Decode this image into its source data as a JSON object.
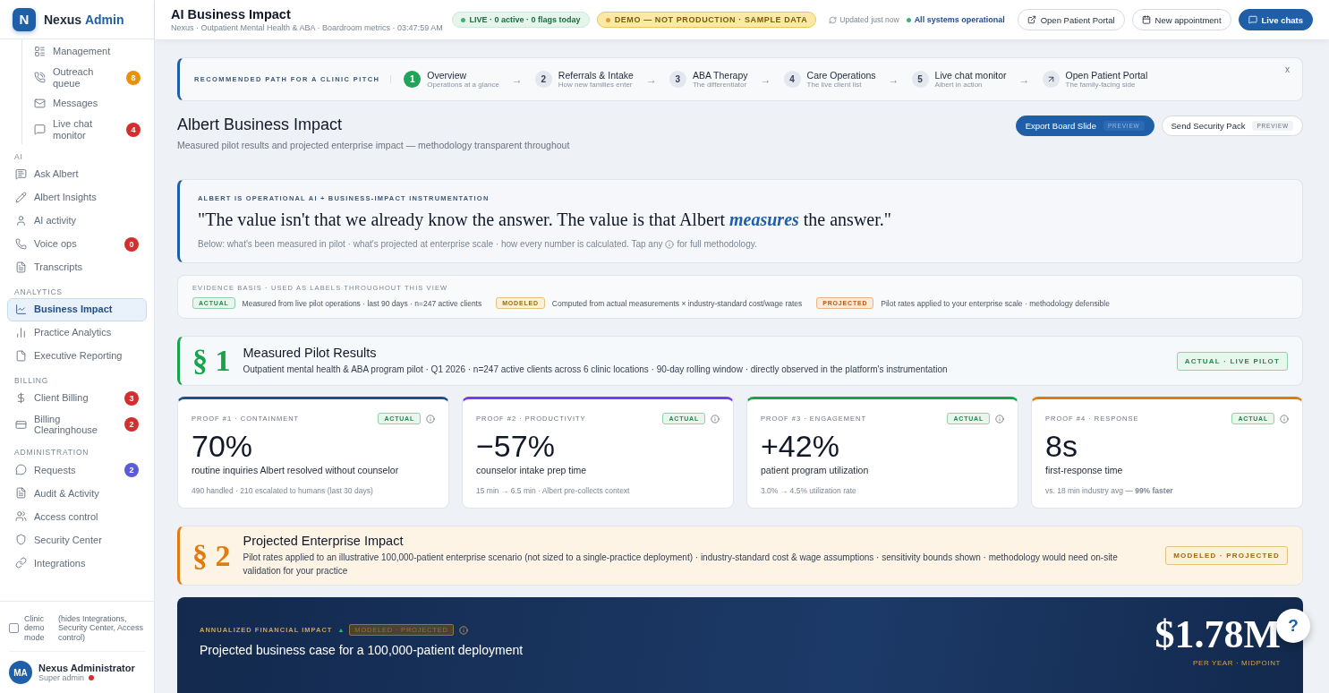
{
  "brand": {
    "logo": "N",
    "name": "Nexus",
    "name_accent": "Admin"
  },
  "sidebar": {
    "sections": [
      {
        "indented": true,
        "items": [
          {
            "label": "Management",
            "selected": false
          },
          {
            "label": "Outreach queue",
            "selected": false,
            "badge": "8",
            "color": "#e8910c"
          },
          {
            "label": "Messages",
            "selected": false
          },
          {
            "label": "Live chat monitor",
            "selected": false,
            "badge": "4",
            "color": "#d32f2f"
          }
        ]
      },
      {
        "indented": false,
        "title": "AI",
        "items": [
          {
            "label": "Ask Albert",
            "selected": false
          },
          {
            "label": "Albert Insights",
            "selected": false
          },
          {
            "label": "AI activity",
            "selected": false
          },
          {
            "label": "Voice ops",
            "selected": false,
            "badge": "0",
            "color": "#d32f2f"
          },
          {
            "label": "Transcripts",
            "selected": false
          }
        ]
      },
      {
        "indented": false,
        "title": "ANALYTICS",
        "items": [
          {
            "label": "Business Impact",
            "selected": true
          },
          {
            "label": "Practice Analytics",
            "selected": false
          },
          {
            "label": "Executive Reporting",
            "selected": false
          }
        ]
      },
      {
        "indented": false,
        "title": "BILLING",
        "items": [
          {
            "label": "Client Billing",
            "selected": false,
            "badge": "3",
            "color": "#d32f2f"
          },
          {
            "label": "Billing Clearinghouse",
            "selected": false,
            "badge": "2",
            "color": "#d32f2f"
          }
        ]
      },
      {
        "indented": false,
        "title": "ADMINISTRATION",
        "items": [
          {
            "label": "Requests",
            "selected": false,
            "badge": "2",
            "color": "#5b5bd6"
          },
          {
            "label": "Audit & Activity",
            "selected": false
          },
          {
            "label": "Access control",
            "selected": false
          },
          {
            "label": "Security Center",
            "selected": false
          },
          {
            "label": "Integrations",
            "selected": false
          }
        ]
      }
    ],
    "demo_mode": {
      "label": "Clinic demo mode",
      "note": "(hides Integrations, Security Center, Access control)",
      "checked": false
    },
    "user": {
      "initials": "MA",
      "name": "Nexus Administrator",
      "role": "Super admin",
      "color": "#d32f2f"
    }
  },
  "header": {
    "title": "AI Business Impact",
    "subtitle": "Nexus · Outpatient Mental Health & ABA · Boardroom metrics · 03:47:59 AM",
    "live_pill": "LIVE · 0 active · 0 flags today",
    "demo_pill": "DEMO — NOT PRODUCTION · SAMPLE DATA",
    "updated": "Updated",
    "updated_when": "just now",
    "status": "All systems operational",
    "buttons": [
      {
        "label": "Open Patient Portal",
        "kind": "outline"
      },
      {
        "label": "New appointment",
        "kind": "outline"
      },
      {
        "label": "Live chats",
        "kind": "primary"
      }
    ]
  },
  "pitch_path": {
    "label": "RECOMMENDED PATH FOR A CLINIC PITCH",
    "close": "x",
    "arrow": "→",
    "steps": [
      {
        "kind": "number",
        "number": "1",
        "title": "Overview",
        "subtitle": "Operations at a glance",
        "selected": true
      },
      {
        "kind": "number",
        "number": "2",
        "title": "Referrals & Intake",
        "subtitle": "How new families enter",
        "selected": false
      },
      {
        "kind": "number",
        "number": "3",
        "title": "ABA Therapy",
        "subtitle": "The differentiator",
        "selected": false
      },
      {
        "kind": "number",
        "number": "4",
        "title": "Care Operations",
        "subtitle": "The live client list",
        "selected": false
      },
      {
        "kind": "number",
        "number": "5",
        "title": "Live chat monitor",
        "subtitle": "Albert in action",
        "selected": false
      },
      {
        "kind": "link",
        "title": "Open Patient Portal",
        "subtitle": "The family-facing side",
        "selected": false
      }
    ]
  },
  "page": {
    "title": "Albert Business Impact",
    "subtitle": "Measured pilot results and projected enterprise impact — methodology transparent throughout",
    "actions": [
      {
        "label": "Export Board Slide",
        "tag": "PREVIEW",
        "kind": "primary"
      },
      {
        "label": "Send Security Pack",
        "tag": "PREVIEW",
        "kind": "outline"
      }
    ]
  },
  "quote_card": {
    "kicker": "ALBERT IS OPERATIONAL AI + BUSINESS-IMPACT INSTRUMENTATION",
    "quote": "\"The value isn't that we already know the answer. The value is that Albert *measures* the answer.\"",
    "note_before": "Below: what's been measured in pilot · what's projected at enterprise scale · how every number is calculated. Tap any",
    "note_after": "for full methodology."
  },
  "evidence_basis": {
    "title": "EVIDENCE BASIS · USED AS LABELS THROUGHOUT THIS VIEW",
    "items": [
      {
        "kind": "actual",
        "tag": "ACTUAL",
        "text": "Measured from live pilot operations · last 90 days · n=247 active clients"
      },
      {
        "kind": "modeled",
        "tag": "MODELED",
        "text": "Computed from actual measurements × industry-standard cost/wage rates"
      },
      {
        "kind": "projected",
        "tag": "PROJECTED",
        "text": "Pilot rates applied to your enterprise scale · methodology defensible"
      }
    ]
  },
  "section_1": {
    "kind": "actual",
    "number": "§ 1",
    "title": "Measured Pilot Results",
    "text": "Outpatient mental health & ABA program pilot · Q1 2026 · n=247 active clients across 6 clinic locations · 90-day rolling window · directly observed in the platform's instrumentation",
    "badge": "ACTUAL · LIVE PILOT"
  },
  "proof_cards": [
    {
      "kicker": "PROOF #1 · CONTAINMENT",
      "tag": "ACTUAL",
      "value": "70%",
      "label": "routine inquiries Albert resolved without counselor",
      "note": "490 handled · 210 escalated to humans (last 30 days)",
      "color": "#1f4e8c"
    },
    {
      "kicker": "PROOF #2 · PRODUCTIVITY",
      "tag": "ACTUAL",
      "value": "−57%",
      "label": "counselor intake prep time",
      "note": "15 min → 6.5 min · Albert pre-collects context",
      "color": "#7c3aed"
    },
    {
      "kicker": "PROOF #3 · ENGAGEMENT",
      "tag": "ACTUAL",
      "value": "+42%",
      "label": "patient program utilization",
      "note": "3.0% → 4.5% utilization rate",
      "color": "#16a34a"
    },
    {
      "kicker": "PROOF #4 · RESPONSE",
      "tag": "ACTUAL",
      "value": "8s",
      "label": "first-response time",
      "note": "vs. 18 min industry avg — **99% faster**",
      "color": "#e07b12"
    }
  ],
  "section_2": {
    "kind": "modeled",
    "number": "§ 2",
    "title": "Projected Enterprise Impact",
    "text": "Pilot rates applied to an illustrative 100,000-patient enterprise scenario (not sized to a single-practice deployment) · industry-standard cost & wage assumptions · sensitivity bounds shown · methodology would need on-site validation for your practice",
    "badge": "MODELED · PROJECTED"
  },
  "financial_card": {
    "kicker": "ANNUALIZED FINANCIAL IMPACT",
    "trend": "▲",
    "tag": "MODELED · PROJECTED",
    "title": "Projected business case for a 100,000-patient deployment",
    "value": "$1.78M",
    "value_caption": "PER YEAR · MIDPOINT"
  },
  "help_button": "?"
}
